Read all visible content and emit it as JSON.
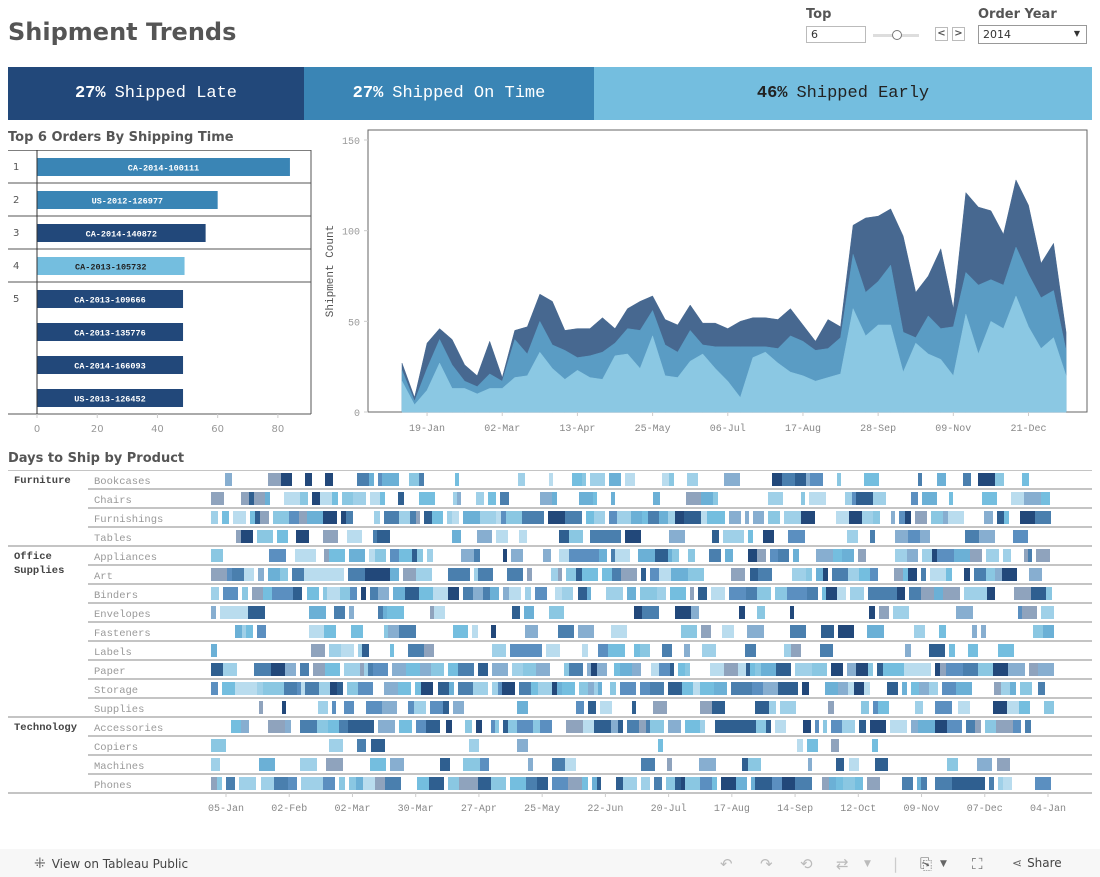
{
  "header": {
    "title": "Shipment Trends",
    "top_label": "Top",
    "top_value": "6",
    "prev_label": "<",
    "next_label": ">",
    "year_label": "Order Year",
    "year_value": "2014"
  },
  "kpis": [
    {
      "pct": "27%",
      "label": "Shipped Late",
      "bg": "#22487a",
      "fg": "#ffffff",
      "share": 27
    },
    {
      "pct": "27%",
      "label": "Shipped On Time",
      "bg": "#3a85b5",
      "fg": "#ffffff",
      "share": 27
    },
    {
      "pct": "46%",
      "label": "Shipped Early",
      "bg": "#74bedf",
      "fg": "#222222",
      "share": 46
    }
  ],
  "colors": {
    "late": "#22487a",
    "on_time": "#3a85b5",
    "early": "#74bedf",
    "area_late": "#476890",
    "area_on_time": "#5a9cc4",
    "area_early": "#8bc8e3"
  },
  "chart_data": [
    {
      "type": "bar",
      "title": "Top 6 Orders By Shipping Time",
      "xlabel": "",
      "ylabel": "",
      "xlim": [
        0,
        90
      ],
      "xticks": [
        "0",
        "20",
        "40",
        "60",
        "80"
      ],
      "groups": [
        {
          "rank": "1",
          "orders": [
            {
              "id": "CA-2014-100111",
              "value": 84,
              "status": "on_time"
            }
          ]
        },
        {
          "rank": "2",
          "orders": [
            {
              "id": "US-2012-126977",
              "value": 60,
              "status": "on_time"
            }
          ]
        },
        {
          "rank": "3",
          "orders": [
            {
              "id": "CA-2014-140872",
              "value": 56,
              "status": "late"
            }
          ]
        },
        {
          "rank": "4",
          "orders": [
            {
              "id": "CA-2013-105732",
              "value": 49,
              "status": "early"
            }
          ]
        },
        {
          "rank": "5",
          "orders": [
            {
              "id": "CA-2013-109666",
              "value": 48.5,
              "status": "late"
            },
            {
              "id": "CA-2013-135776",
              "value": 48.5,
              "status": "late"
            },
            {
              "id": "CA-2014-166093",
              "value": 48.5,
              "status": "late"
            },
            {
              "id": "US-2013-126452",
              "value": 48.5,
              "status": "late"
            }
          ]
        }
      ]
    },
    {
      "type": "area",
      "title": "",
      "ylabel": "Shipment Count",
      "ylim": [
        0,
        150
      ],
      "yticks": [
        "0",
        "50",
        "100",
        "150"
      ],
      "xticks": [
        "19-Jan",
        "02-Mar",
        "13-Apr",
        "25-May",
        "06-Jul",
        "17-Aug",
        "28-Sep",
        "09-Nov",
        "21-Dec"
      ],
      "x_note": "weekly points starting first week of Jan; tick 19-Jan at week index 2",
      "series": [
        {
          "name": "Shipped Early",
          "color_key": "area_early",
          "values": [
            17,
            4,
            12,
            27,
            13,
            13,
            10,
            13,
            13,
            19,
            20,
            33,
            24,
            18,
            23,
            19,
            18,
            31,
            32,
            24,
            42,
            20,
            19,
            28,
            32,
            24,
            17,
            8,
            30,
            33,
            27,
            22,
            20,
            17,
            19,
            21,
            57,
            42,
            48,
            48,
            22,
            38,
            32,
            29,
            20,
            54,
            32,
            50,
            46,
            64,
            47,
            35,
            41,
            20
          ]
        },
        {
          "name": "Shipped On Time",
          "color_key": "area_on_time",
          "values": [
            6,
            2,
            12,
            13,
            13,
            4,
            4,
            8,
            4,
            21,
            12,
            17,
            13,
            16,
            7,
            12,
            15,
            7,
            14,
            21,
            14,
            17,
            14,
            17,
            5,
            12,
            19,
            28,
            6,
            3,
            8,
            20,
            19,
            17,
            16,
            20,
            30,
            24,
            24,
            33,
            22,
            3,
            21,
            17,
            27,
            23,
            38,
            23,
            24,
            27,
            29,
            28,
            26,
            14
          ]
        },
        {
          "name": "Shipped Late",
          "color_key": "area_late",
          "values": [
            4,
            2,
            14,
            6,
            14,
            9,
            6,
            18,
            2,
            5,
            15,
            15,
            24,
            11,
            16,
            15,
            19,
            8,
            11,
            16,
            8,
            14,
            15,
            14,
            12,
            13,
            10,
            14,
            16,
            16,
            16,
            15,
            9,
            5,
            16,
            6,
            16,
            41,
            36,
            31,
            53,
            25,
            22,
            44,
            10,
            44,
            43,
            38,
            28,
            37,
            38,
            19,
            26,
            10
          ]
        }
      ]
    },
    {
      "type": "heatmap",
      "title": "Days to Ship by Product",
      "xticks": [
        "05-Jan",
        "02-Feb",
        "02-Mar",
        "30-Mar",
        "27-Apr",
        "25-May",
        "22-Jun",
        "20-Jul",
        "17-Aug",
        "14-Sep",
        "12-Oct",
        "09-Nov",
        "07-Dec",
        "04-Jan"
      ],
      "categories": [
        {
          "name": "Furniture",
          "rows": [
            "Bookcases",
            "Chairs",
            "Furnishings",
            "Tables"
          ]
        },
        {
          "name": "Office Supplies",
          "rows": [
            "Appliances",
            "Art",
            "Binders",
            "Envelopes",
            "Fasteners",
            "Labels",
            "Paper",
            "Storage",
            "Supplies"
          ]
        },
        {
          "name": "Technology",
          "rows": [
            "Accessories",
            "Copiers",
            "Machines",
            "Phones"
          ]
        }
      ],
      "row_density": {
        "Bookcases": 0.45,
        "Chairs": 0.6,
        "Furnishings": 0.85,
        "Tables": 0.45,
        "Appliances": 0.65,
        "Art": 0.8,
        "Binders": 0.9,
        "Envelopes": 0.45,
        "Fasteners": 0.5,
        "Labels": 0.5,
        "Paper": 0.85,
        "Storage": 0.85,
        "Supplies": 0.5,
        "Accessories": 0.8,
        "Copiers": 0.15,
        "Machines": 0.3,
        "Phones": 0.9
      },
      "legend": "color intensity = days to ship (light = fewer, dark = more)"
    }
  ],
  "footer": {
    "view_label": "View on Tableau Public",
    "share_label": "Share"
  }
}
